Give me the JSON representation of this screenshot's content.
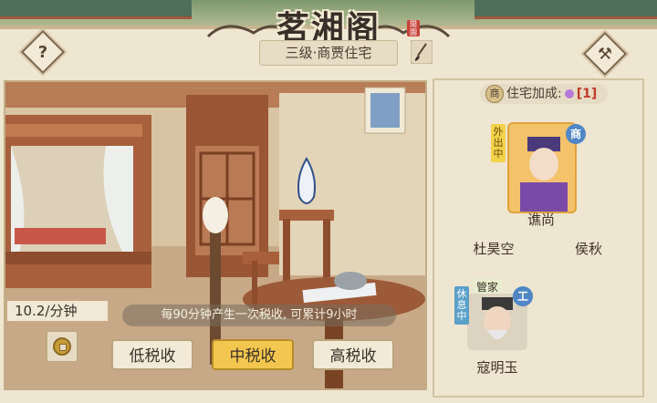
{
  "header": {
    "title": "茗湘阁",
    "seal": "閒園",
    "subtitle": "三级·商贾住宅"
  },
  "buttons": {
    "help_label": "?",
    "build_label": "⚒"
  },
  "bonus": {
    "badge": "商",
    "label": "住宅加成:",
    "value": "[1]"
  },
  "residents": [
    {
      "name": "谯尚",
      "tag": "外出中",
      "role": "商"
    },
    {
      "name": "杜昊空"
    },
    {
      "name": "侯秋"
    },
    {
      "name": "寇明玉",
      "title": "管家",
      "tag": "休息中",
      "role": "工"
    }
  ],
  "tax": {
    "rate": "10.2/分钟",
    "info": "每90分钟产生一次税收, 可累计9小时",
    "low": "低税收",
    "mid": "中税收",
    "high": "高税收",
    "selected": "中税收"
  },
  "colors": {
    "accent": "#f3c74f",
    "panel": "#efe6d2",
    "merchant_badge": "#4f86c6"
  }
}
